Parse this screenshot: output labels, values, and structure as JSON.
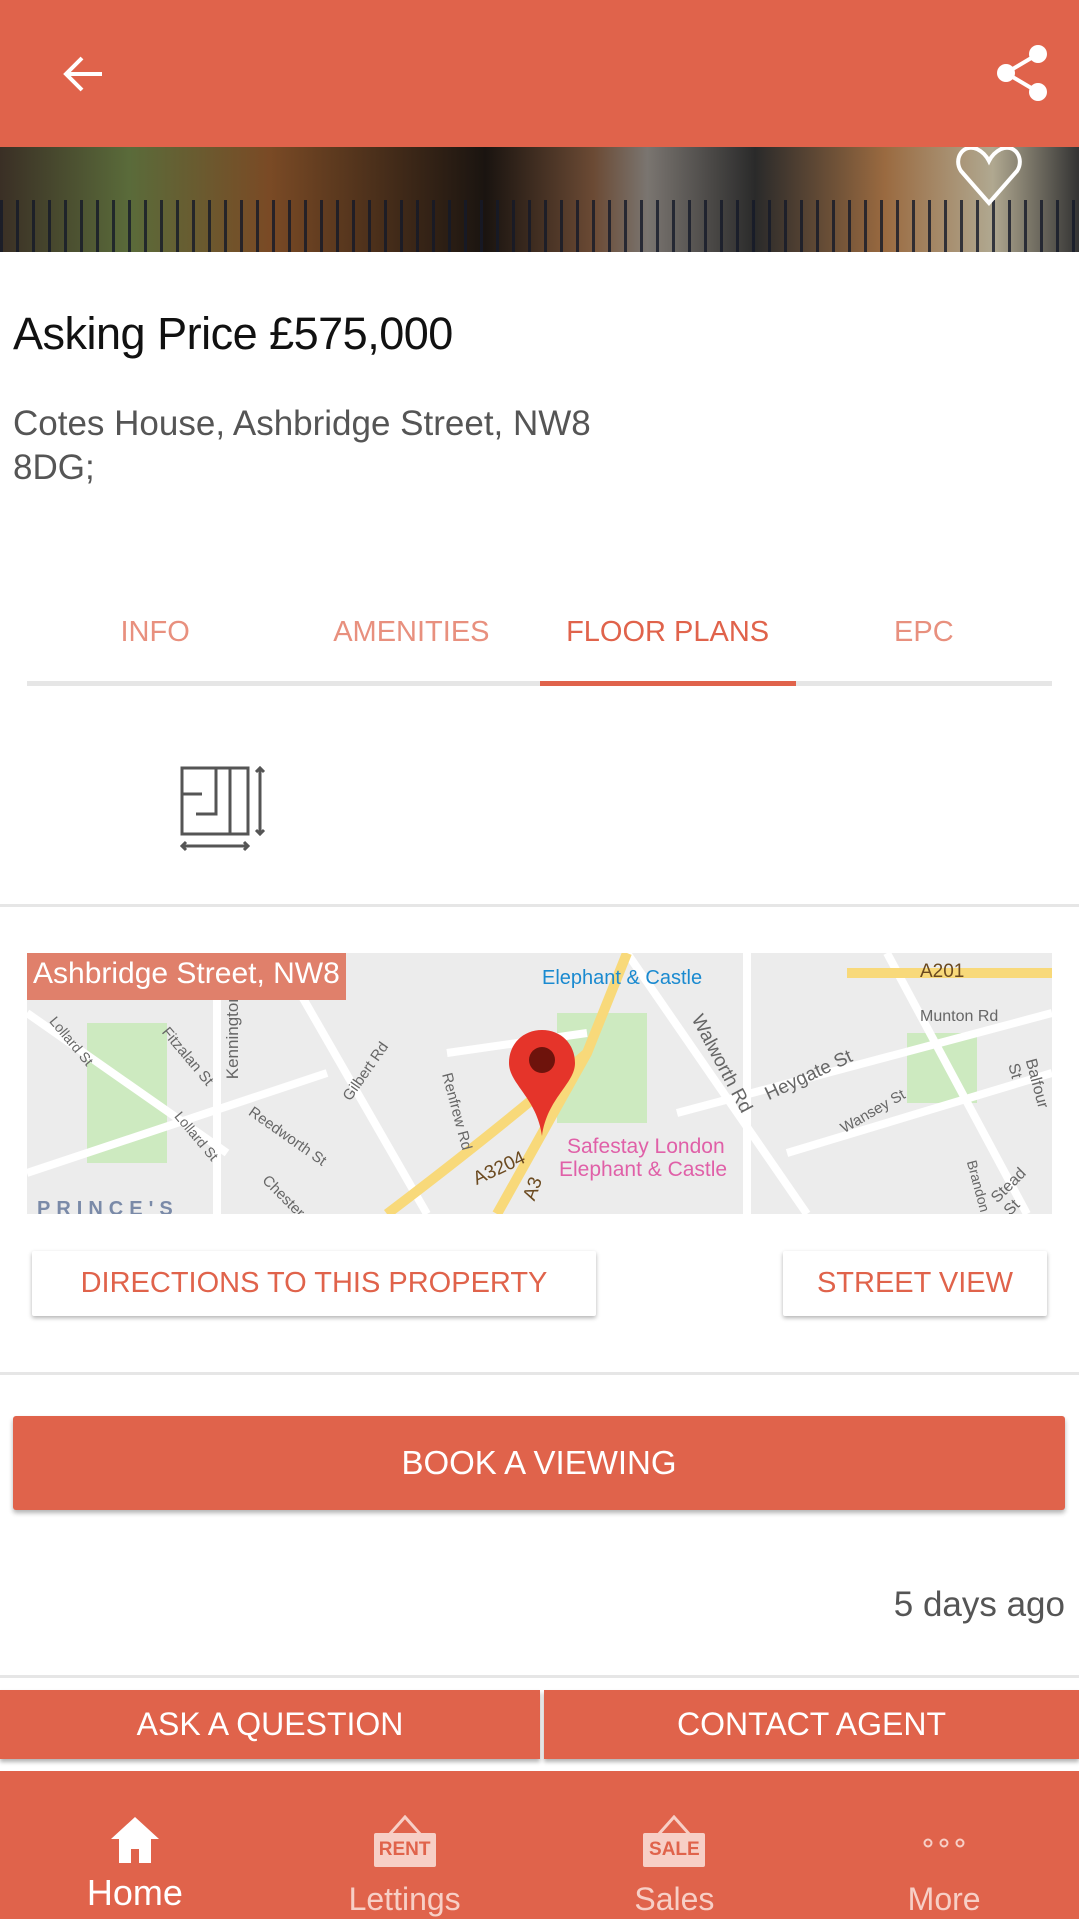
{
  "header": {
    "back_icon": "arrow-left-icon",
    "share_icon": "share-icon"
  },
  "hero": {
    "favorite_icon": "heart-outline-icon"
  },
  "listing": {
    "price": "Asking Price £575,000",
    "address_line1": "Cotes House, Ashbridge Street, NW8",
    "address_line2": "8DG;"
  },
  "tabs": [
    {
      "label": "INFO",
      "active": false
    },
    {
      "label": "AMENITIES",
      "active": false
    },
    {
      "label": "FLOOR PLANS",
      "active": true
    },
    {
      "label": "EPC",
      "active": false
    }
  ],
  "floorplan": {
    "icon": "floor-plan-icon"
  },
  "map": {
    "label": "Ashbridge Street, NW8",
    "places": [
      "Elephant & Castle",
      "A201",
      "Munton Rd",
      "Walworth Rd",
      "Heygate St",
      "Wansey St",
      "Balfour St",
      "Stead St",
      "Safestay London",
      "Elephant & Castle",
      "A3204",
      "A3",
      "Gilbert Rd",
      "Renfrew Rd",
      "Reedworth St",
      "Fitzalan St",
      "Lollard St",
      "Lollard St",
      "Kennington Rd",
      "Chester",
      "Brandon",
      "PRINCE'S"
    ]
  },
  "actions": {
    "directions": "DIRECTIONS TO THIS PROPERTY",
    "street_view": "STREET VIEW",
    "book": "BOOK A VIEWING",
    "posted": "5 days ago",
    "ask": "ASK A QUESTION",
    "contact": "CONTACT AGENT"
  },
  "bottom_nav": [
    {
      "label": "Home",
      "icon": "home-icon",
      "active": true
    },
    {
      "label": "Lettings",
      "icon": "rent-sign-icon",
      "sign": "RENT",
      "active": false
    },
    {
      "label": "Sales",
      "icon": "sale-sign-icon",
      "sign": "SALE",
      "active": false
    },
    {
      "label": "More",
      "icon": "more-dots-icon",
      "active": false
    }
  ],
  "colors": {
    "brand": "#E0634B",
    "tab_inactive": "#e8907e"
  }
}
